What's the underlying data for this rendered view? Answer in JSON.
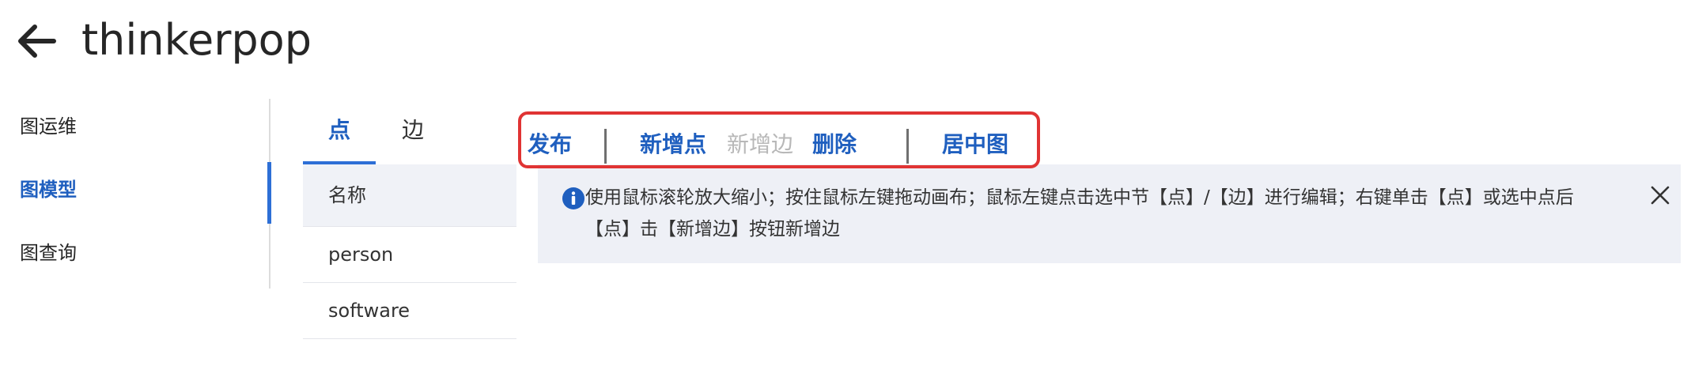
{
  "header": {
    "title": "thinkerpop",
    "back_icon": "arrow-left-icon"
  },
  "sidebar": {
    "items": [
      {
        "label": "图运维",
        "active": false
      },
      {
        "label": "图模型",
        "active": true
      },
      {
        "label": "图查询",
        "active": false
      }
    ]
  },
  "tabs": [
    {
      "label": "点",
      "active": true
    },
    {
      "label": "边",
      "active": false
    }
  ],
  "vertex_table": {
    "header": "名称",
    "rows": [
      "person",
      "software"
    ]
  },
  "toolbar": {
    "publish": "发布",
    "add_vertex": "新增点",
    "add_edge": "新增边",
    "delete": "删除",
    "center_graph": "居中图"
  },
  "info": {
    "text": "使用鼠标滚轮放大缩小；按住鼠标左键拖动画布；鼠标左键点击选中节【点】/【边】进行编辑；右键单击【点】或选中点后【点】击【新增边】按钮新增边",
    "icon": "info-icon",
    "close_icon": "close-icon"
  },
  "colors": {
    "accent": "#1f5fbf",
    "highlight_border": "#e03434",
    "banner_bg": "#eef0f6"
  }
}
